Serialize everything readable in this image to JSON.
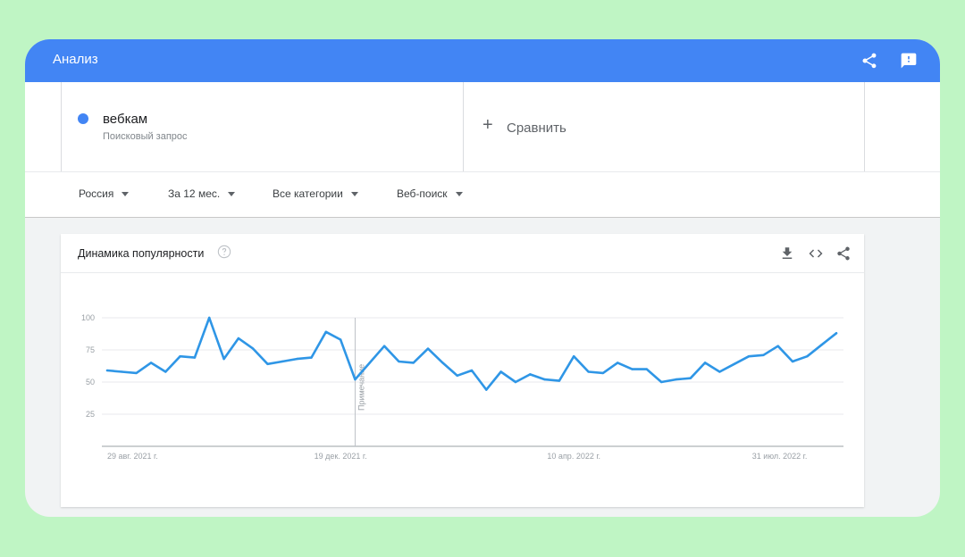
{
  "topbar": {
    "title": "Анализ",
    "icons": [
      "share-icon",
      "feedback-icon"
    ],
    "color": "#4285f4"
  },
  "term": {
    "name": "вебкам",
    "type": "Поисковый запрос",
    "color": "#4285f4"
  },
  "compare": {
    "icon": "plus-icon",
    "label": "Сравнить"
  },
  "filters": [
    {
      "label": "Россия"
    },
    {
      "label": "За 12 мес."
    },
    {
      "label": "Все категории"
    },
    {
      "label": "Веб-поиск"
    }
  ],
  "card": {
    "title": "Динамика популярности",
    "icons": [
      "help-icon",
      "download-icon",
      "embed-icon",
      "share-icon"
    ]
  },
  "chart_data": {
    "type": "line",
    "title": "",
    "xlabel": "",
    "ylabel": "",
    "ylim": [
      0,
      100
    ],
    "y_ticks": [
      25,
      50,
      75,
      100
    ],
    "x_tick_labels": [
      "29 авг. 2021 г.",
      "19 дек. 2021 г.",
      "10 апр. 2022 г.",
      "31 июл. 2022 г."
    ],
    "x_tick_index": [
      0,
      16,
      32,
      48
    ],
    "grid": true,
    "annotation": {
      "label": "Примечание",
      "index": 17
    },
    "series": [
      {
        "color": "#2f96e6",
        "values": [
          59,
          58,
          57,
          65,
          58,
          70,
          69,
          100,
          68,
          84,
          76,
          64,
          66,
          68,
          69,
          89,
          83,
          52,
          65,
          78,
          66,
          65,
          76,
          65,
          55,
          59,
          44,
          58,
          50,
          56,
          52,
          51,
          70,
          58,
          57,
          65,
          60,
          60,
          50,
          52,
          53,
          65,
          58,
          64,
          70,
          71,
          78,
          66,
          70,
          79,
          88
        ]
      }
    ]
  }
}
